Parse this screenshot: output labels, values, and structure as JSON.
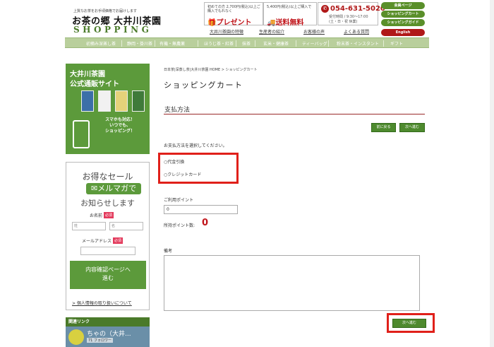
{
  "header": {
    "tagline": "上質なお茶をお手頃価格でお届けします",
    "logo_main": "お茶の郷 大井川茶園",
    "logo_sub": "SHOPPING",
    "promo1_small": "初めての方 2,700円(税込)以上ご購入でもれなく",
    "promo1_big": "プレゼント",
    "promo2_small": "5,400円(税込)以上ご購入で",
    "promo2_big": "送料無料",
    "phone": "054-631-5020",
    "phone_hours": "受付時間 / 9:30～17:00\n(土・日・祝 休業)",
    "pills": [
      "会員ページ",
      "ショッピングカート",
      "ショッピングガイド",
      "English"
    ]
  },
  "sublinks": [
    "大井川茶園の特徴",
    "生産者の紹介",
    "お客様の声",
    "よくある質問"
  ],
  "nav": [
    "初摘み深蒸し茶",
    "静岡・掛川茶",
    "有機・無農薬",
    "ほうじ茶・紅茶",
    "抹茶",
    "玄米・健康茶",
    "ティーバッグ",
    "粉末茶・インスタント",
    "ギフト"
  ],
  "sidebar": {
    "banner_title1": "大井川茶園",
    "banner_title2": "公式通販サイト",
    "banner_sub": "スマホも対応！\nいつでも、\nショッピング！",
    "mag_t1": "お得なセール",
    "mag_t2": "メルマガで",
    "mag_t3": "お知らせします",
    "name_label": "お名前",
    "required": "必須",
    "last_name_placeholder": "姓",
    "first_name_placeholder": "名",
    "email_label": "メールアドレス",
    "confirm_button": "内容確認ページへ\n進む",
    "privacy_link": "> 個人情報の取り扱いについて",
    "related_header": "関連リンク",
    "related_name": "ちゃの（大井...",
    "related_follow": "71 フォロワー"
  },
  "main": {
    "breadcrumb": "日本茶|深蒸し茶|大井川茶園 HOME > ショッピングカート",
    "page_title": "ショッピングカート",
    "section_title": "支払方法",
    "back_button": "前に戻る",
    "next_button_top": "次へ進む",
    "instruction": "お支払方法を選択してください。",
    "payment_options": [
      "代金引換",
      "クレジットカード"
    ],
    "points_label": "ご利用ポイント",
    "points_value": "0",
    "owned_points_label": "所持ポイント数:",
    "owned_points_value": "0",
    "notes_label": "備考",
    "next_button_bottom": "次へ進む"
  },
  "colors": {
    "brand_green": "#5c9a3b",
    "nav_green": "#b9cf9c",
    "highlight_red": "#e0201a",
    "accent_red": "#c0141a"
  }
}
